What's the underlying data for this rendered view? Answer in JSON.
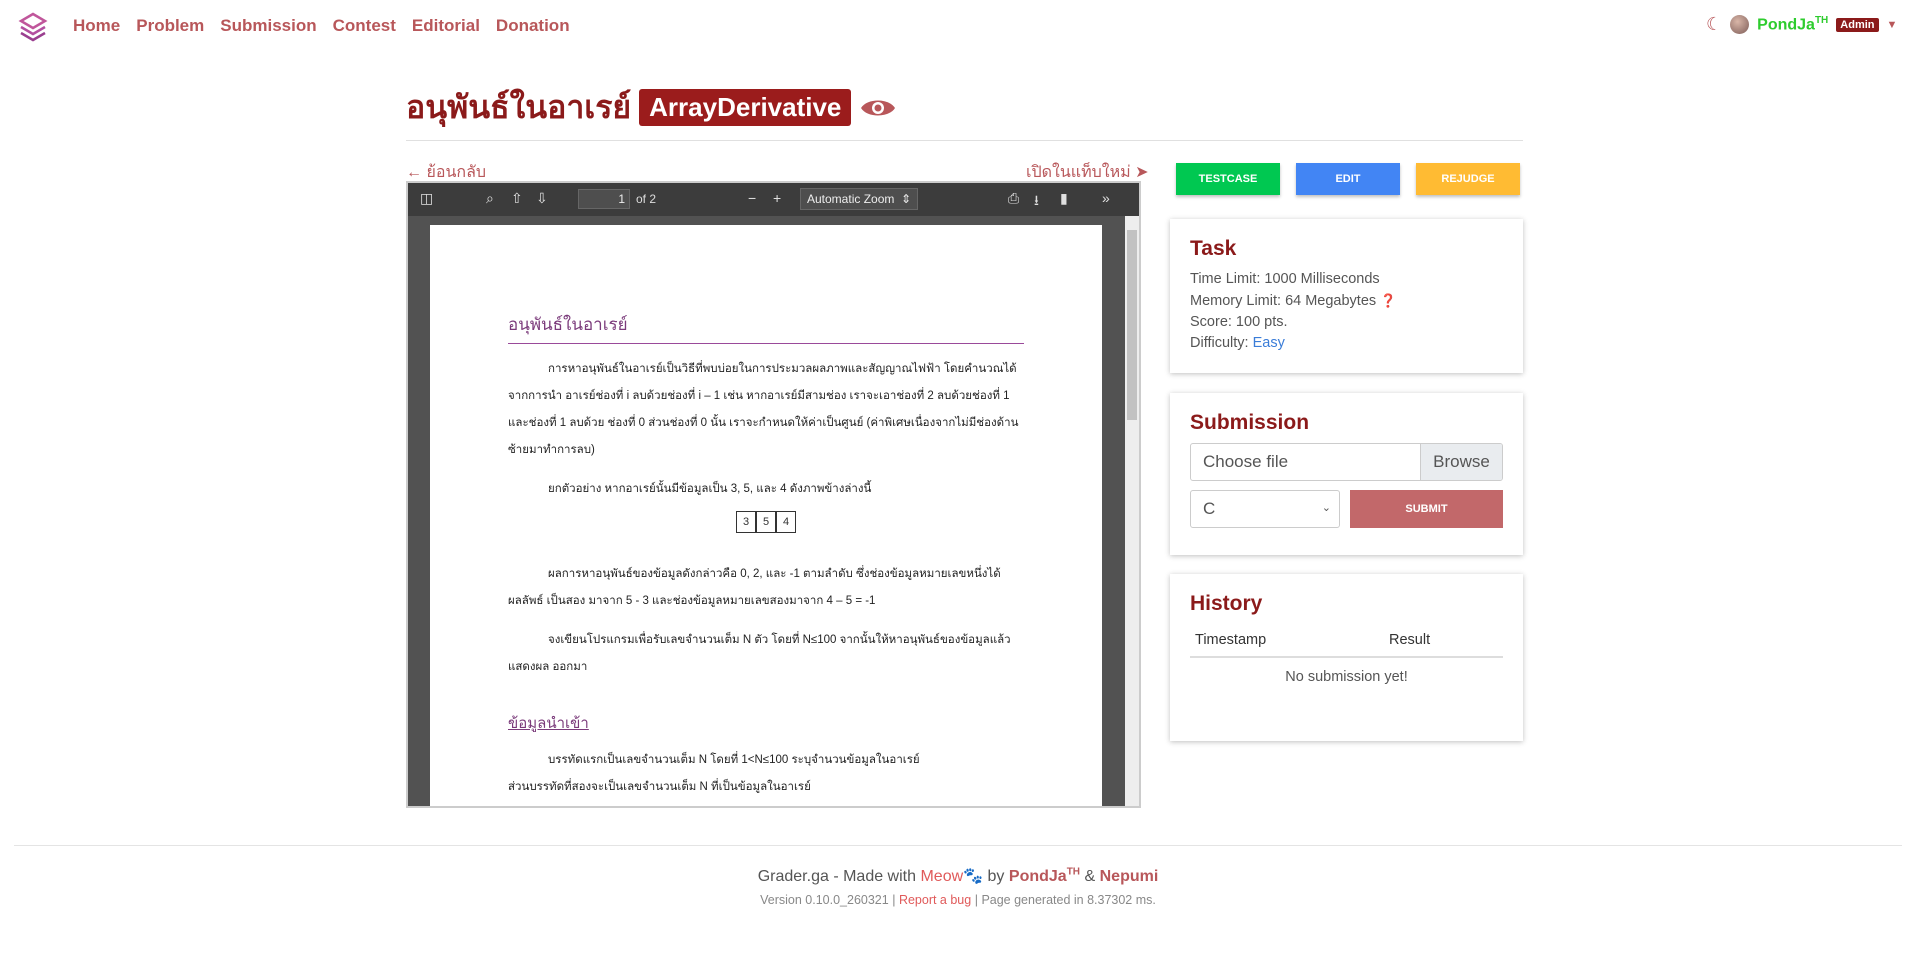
{
  "nav": {
    "items": [
      "Home",
      "Problem",
      "Submission",
      "Contest",
      "Editorial",
      "Donation"
    ],
    "user": "PondJa",
    "user_sup": "TH",
    "badge": "Admin"
  },
  "problem": {
    "title_th": "อนุพันธ์ในอาเรย์",
    "title_en": "ArrayDerivative",
    "back": "ย้อนกลับ",
    "open_new": "เปิดในแท็บใหม่"
  },
  "pdf": {
    "page": "1",
    "of": "of 2",
    "zoom": "Automatic Zoom",
    "heading": "อนุพันธ์ในอาเรย์",
    "p1": "การหาอนุพันธ์ในอาเรย์เป็นวิธีที่พบบ่อยในการประมวลผลภาพและสัญญาณไฟฟ้า โดยคำนวณได้จากการนำ อาเรย์ช่องที่ i ลบด้วยช่องที่ i – 1 เช่น หากอาเรย์มีสามช่อง เราจะเอาช่องที่ 2 ลบด้วยช่องที่ 1 และช่องที่ 1 ลบด้วย ช่องที่ 0 ส่วนช่องที่ 0 นั้น เราจะกำหนดให้ค่าเป็นศูนย์ (ค่าพิเศษเนื่องจากไม่มีช่องด้านซ้ายมาทำการลบ)",
    "p2": "ยกตัวอย่าง หากอาเรย์นั้นมีข้อมูลเป็น 3, 5, และ 4 ดังภาพข้างล่างนี้",
    "boxes": [
      "3",
      "5",
      "4"
    ],
    "p3": "ผลการหาอนุพันธ์ของข้อมูลดังกล่าวคือ 0, 2, และ -1 ตามลำดับ ซึ่งช่องข้อมูลหมายเลขหนึ่งได้ผลลัพธ์ เป็นสอง มาจาก 5 - 3 และช่องข้อมูลหมายเลขสองมาจาก 4 – 5 = -1",
    "p4": "จงเขียนโปรแกรมเพื่อรับเลขจำนวนเต็ม N ตัว โดยที่ N≤100 จากนั้นให้หาอนุพันธ์ของข้อมูลแล้วแสดงผล ออกมา",
    "heading2": "ข้อมูลนำเข้า",
    "p5": "บรรทัดแรกเป็นเลขจำนวนเต็ม N โดยที่ 1<N≤100 ระบุจำนวนข้อมูลในอาเรย์",
    "p6": "ส่วนบรรทัดที่สองจะเป็นเลขจำนวนเต็ม N ที่เป็นข้อมูลในอาเรย์"
  },
  "actions": {
    "testcase": "TESTCASE",
    "edit": "EDIT",
    "rejudge": "REJUDGE"
  },
  "task": {
    "title": "Task",
    "time": "Time Limit: 1000 Milliseconds",
    "memory": "Memory Limit: 64 Megabytes",
    "score": "Score: 100 pts.",
    "difficulty_label": "Difficulty:",
    "difficulty": "Easy"
  },
  "submission": {
    "title": "Submission",
    "file_placeholder": "Choose file",
    "browse": "Browse",
    "lang": "C",
    "submit": "SUBMIT"
  },
  "history": {
    "title": "History",
    "col1": "Timestamp",
    "col2": "Result",
    "empty": "No submission yet!"
  },
  "footer": {
    "site": "Grader.ga",
    "made": "- Made with",
    "meow": "Meow",
    "by": "by",
    "a1": "PondJa",
    "a1sup": "TH",
    "amp": "&",
    "a2": "Nepumi",
    "version": "Version 0.10.0_260321",
    "sep": "|",
    "bug": "Report a bug",
    "gen": "Page generated in 8.37302 ms."
  },
  "colors": {
    "accent": "#8b1a1a",
    "link": "#b8575a",
    "testcase": "#00c851",
    "edit": "#4285f4",
    "rejudge": "#ffbb33",
    "submit": "#c2686a"
  }
}
